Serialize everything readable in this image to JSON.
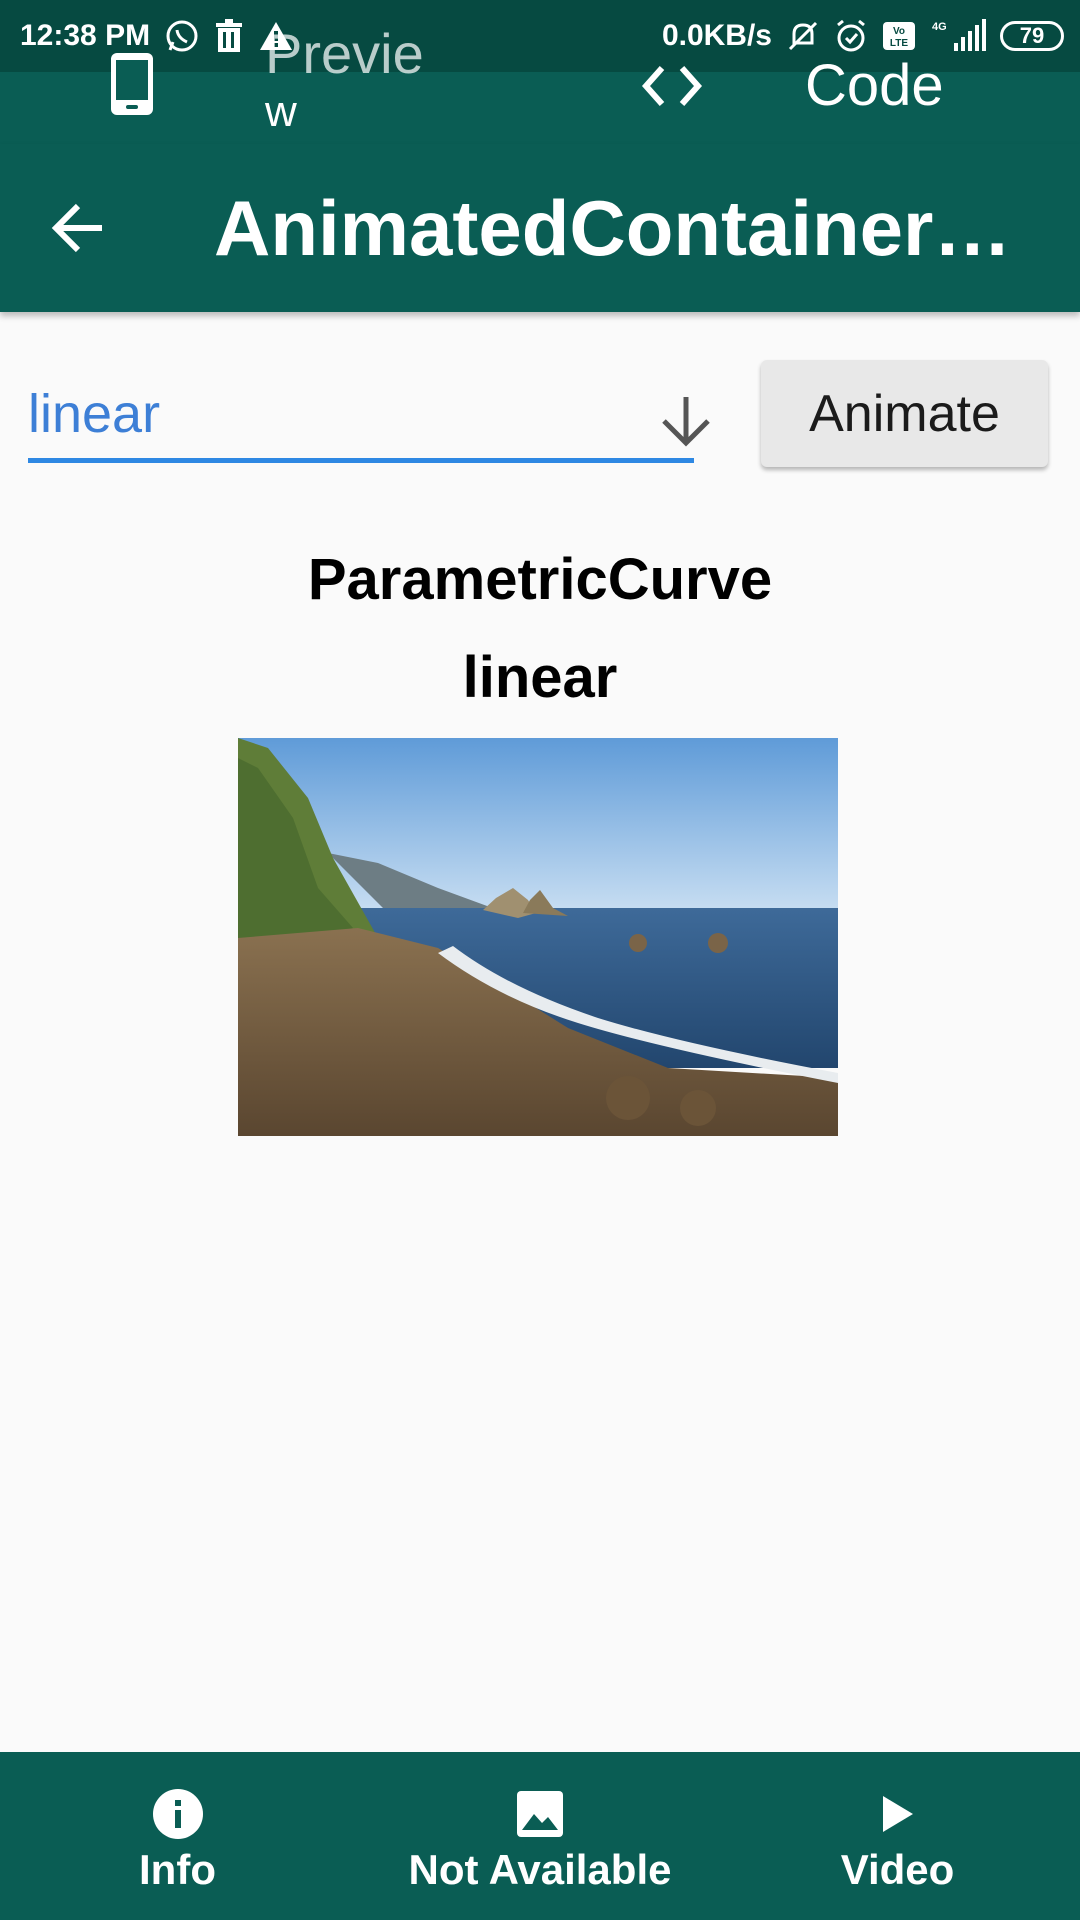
{
  "status_bar": {
    "time": "12:38 PM",
    "net_speed": "0.0KB/s",
    "network": "4G",
    "volte": "Vo LTE",
    "battery": "79",
    "icons": [
      "whatsapp-icon",
      "delete-icon",
      "warning-icon",
      "mute-icon",
      "alarm-icon",
      "volte-icon",
      "signal-icon",
      "battery-icon"
    ]
  },
  "tabs": {
    "preview_label_line1": "Previe",
    "preview_label_line2": "w",
    "code_label": "Code",
    "icons": [
      "phone-icon",
      "code-icon"
    ]
  },
  "app_bar": {
    "title": "AnimatedContainer ..."
  },
  "controls": {
    "dropdown_value": "linear",
    "animate_label": "Animate"
  },
  "content": {
    "curve_title": "ParametricCurve",
    "curve_name": "linear"
  },
  "bottom_nav": {
    "items": [
      {
        "label": "Info",
        "icon": "info-icon"
      },
      {
        "label": "Not Available",
        "icon": "image-icon"
      },
      {
        "label": "Video",
        "icon": "play-icon"
      }
    ]
  },
  "colors": {
    "primary": "#0a5d54",
    "status_bar": "#064a41",
    "accent": "#2e88e3",
    "background": "#fafafa"
  }
}
